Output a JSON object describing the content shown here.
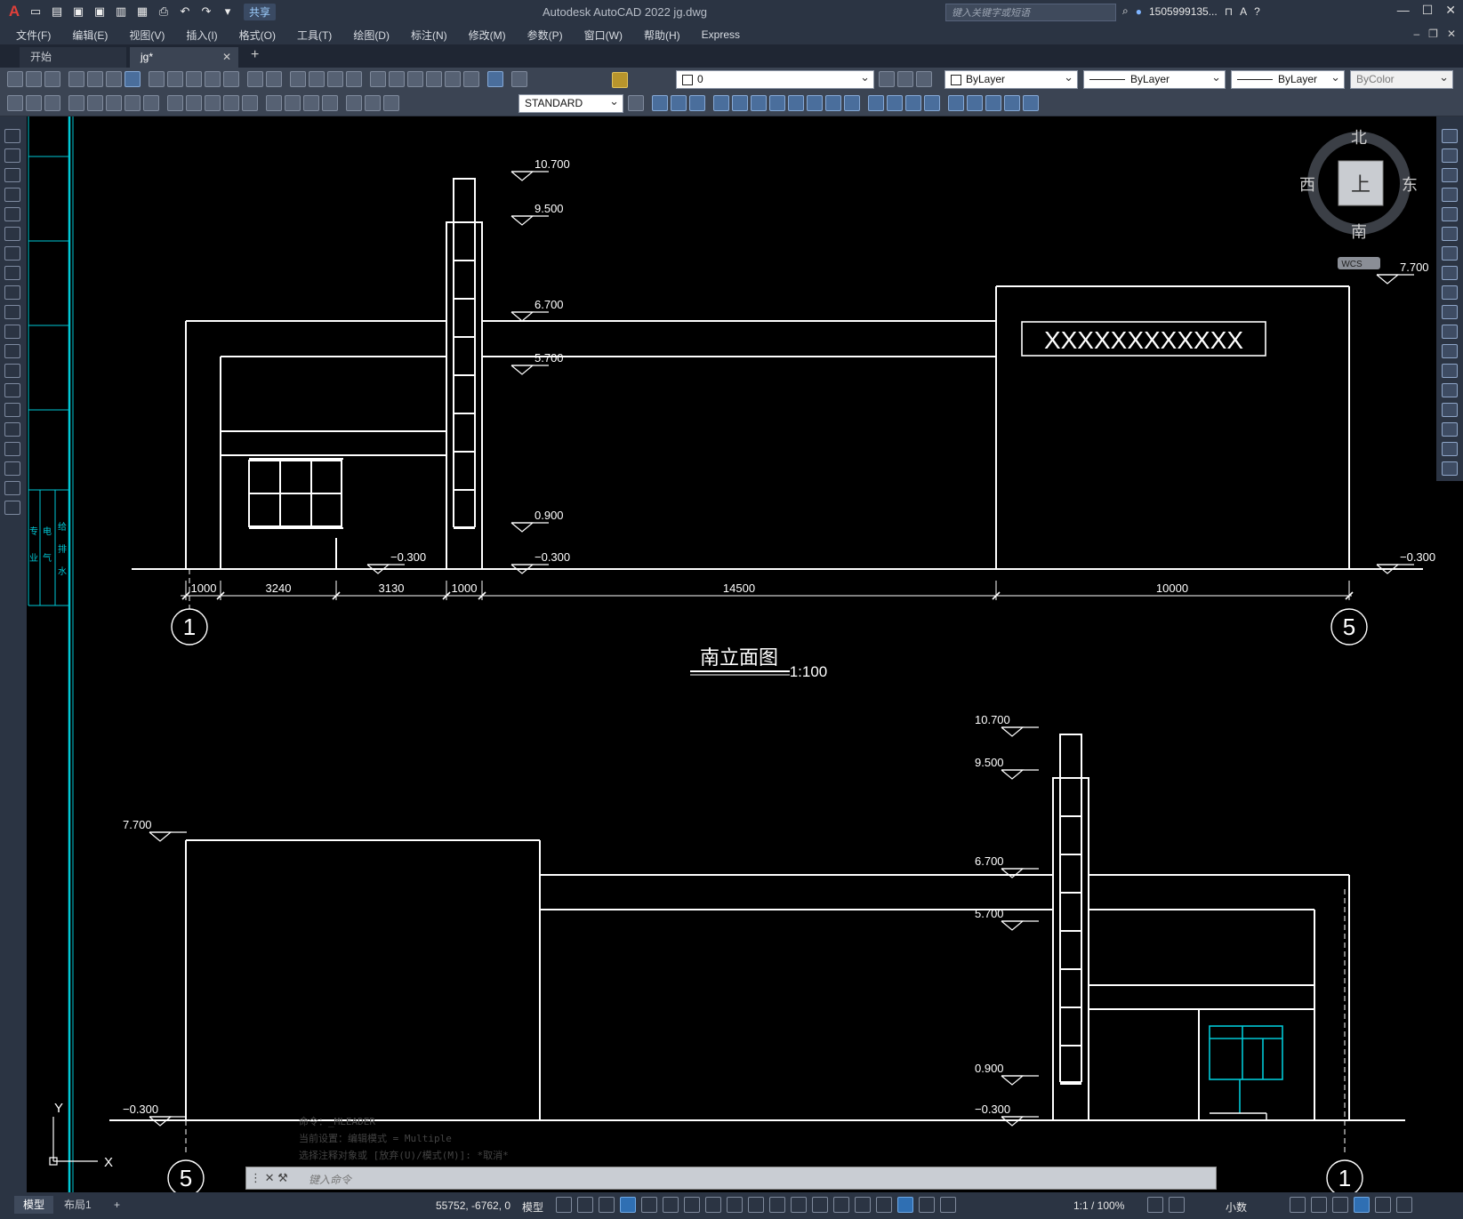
{
  "app": {
    "title": "Autodesk AutoCAD 2022    jg.dwg",
    "search_placeholder": "键入关键字或短语",
    "user": "1505999135...",
    "share_label": "共享"
  },
  "menu": [
    "文件(F)",
    "编辑(E)",
    "视图(V)",
    "插入(I)",
    "格式(O)",
    "工具(T)",
    "绘图(D)",
    "标注(N)",
    "修改(M)",
    "参数(P)",
    "窗口(W)",
    "帮助(H)",
    "Express"
  ],
  "tabs": {
    "start": "开始",
    "active": "jg*",
    "close": "✕",
    "add": "+"
  },
  "properties": {
    "layer": "0",
    "color": "ByLayer",
    "linetype": "ByLayer",
    "lineweight": "ByLayer",
    "plotstyle": "ByColor",
    "textstyle": "STANDARD"
  },
  "viewcube": {
    "north": "北",
    "south": "南",
    "east": "东",
    "west": "西",
    "face": "上",
    "wcs": "WCS"
  },
  "drawing": {
    "elev1": {
      "title": "南立面图",
      "scale": "1:100",
      "levels": [
        "10.700",
        "9.500",
        "6.700",
        "5.700",
        "0.900",
        "−0.300",
        "−0.300",
        "7.700",
        "−0.300"
      ],
      "dims": [
        "1000",
        "3240",
        "3130",
        "1000",
        "14500",
        "10000"
      ],
      "axes": [
        "1",
        "5"
      ],
      "sign": "XXXXXXXXXXXX"
    },
    "elev2": {
      "levels": [
        "10.700",
        "9.500",
        "6.700",
        "5.700",
        "0.900",
        "−0.300",
        "7.700",
        "−0.300"
      ],
      "axes": [
        "5",
        "1"
      ]
    },
    "ucs": {
      "x": "X",
      "y": "Y"
    }
  },
  "command": {
    "placeholder": "键入命令",
    "history": [
      "命令：_MLEADER",
      "当前设置：编辑模式 = Multiple",
      "选择注释对象或 [放弃(U)/模式(M)]: *取消*"
    ]
  },
  "status": {
    "model_tab": "模型",
    "layout_tab": "布局1",
    "coords": "55752, -6762, 0",
    "space": "模型",
    "scale": "1:1 / 100%",
    "units": "小数"
  }
}
